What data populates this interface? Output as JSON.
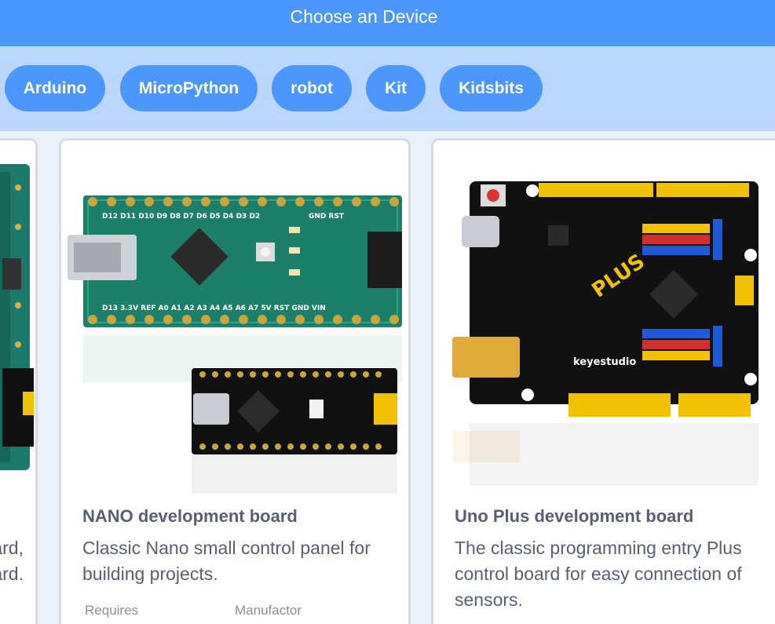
{
  "header": {
    "title": "Choose an Device"
  },
  "filters": [
    {
      "label": "Arduino"
    },
    {
      "label": "MicroPython"
    },
    {
      "label": "robot"
    },
    {
      "label": "Kit"
    },
    {
      "label": "Kidsbits"
    }
  ],
  "cards": {
    "partial": {
      "desc_line1": "ard,",
      "desc_line2": "ard."
    },
    "nano": {
      "name": "NANO development board",
      "description": "Classic Nano small control panel for building projects.",
      "meta_requires": "Requires",
      "meta_manufactor": "Manufactor"
    },
    "uno": {
      "name": "Uno Plus development board",
      "description": "The classic programming entry Plus control board for easy connection of sensors."
    }
  },
  "board_labels": {
    "nano_top": [
      "D12",
      "D11",
      "D10",
      "D9",
      "D8",
      "D7",
      "D6",
      "D5",
      "D4",
      "D3",
      "D2",
      "GND",
      "RST"
    ],
    "nano_bottom": [
      "D13",
      "3.3V",
      "REF",
      "A0",
      "A1",
      "A2",
      "A3",
      "A4",
      "A5",
      "A6",
      "A7",
      "5V",
      "RST",
      "GND",
      "VIN"
    ],
    "uno_brand": "keyestudio",
    "uno_plus": "PLUS"
  },
  "colors": {
    "header": "#4c97ff",
    "filter_bar": "#bdd6fb",
    "chip": "#4c97ff",
    "background": "#e9f1fd",
    "card_text": "#575e75"
  }
}
